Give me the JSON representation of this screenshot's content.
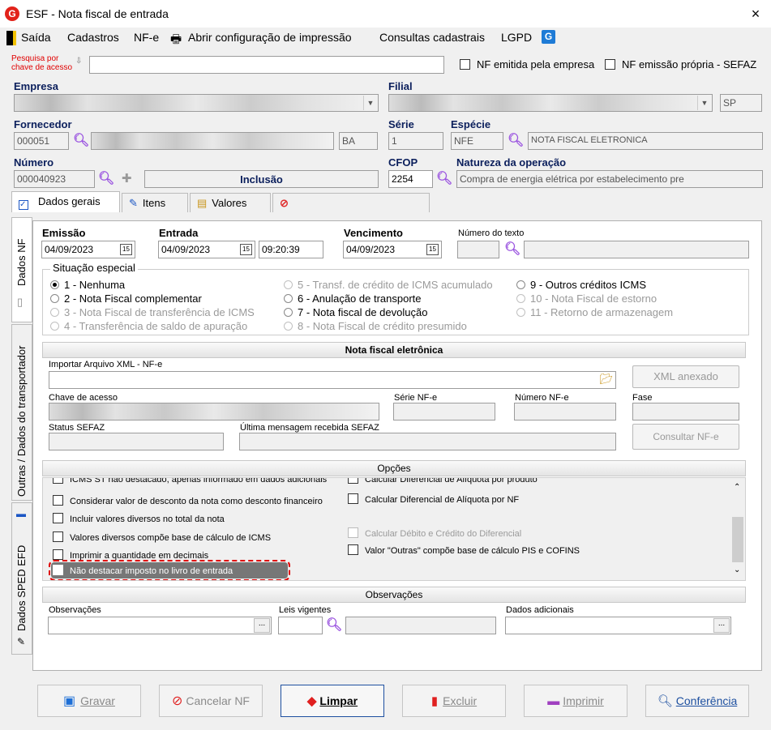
{
  "window": {
    "title": "ESF - Nota fiscal de entrada",
    "close": "×",
    "logo": "G"
  },
  "menu": {
    "saida": "Saída",
    "cadastros": "Cadastros",
    "nfe": "NF-e",
    "print_config": "Abrir configuração de impressão",
    "consultas": "Consultas cadastrais",
    "lgpd": "LGPD"
  },
  "search": {
    "label": "Pesquisa por chave de acesso",
    "value": "",
    "nf_emitida": "NF emitida pela empresa",
    "nf_propria": "NF emissão própria - SEFAZ"
  },
  "empresa": {
    "label": "Empresa",
    "value": ""
  },
  "filial": {
    "label": "Filial",
    "value": "",
    "uf": "SP"
  },
  "fornecedor": {
    "label": "Fornecedor",
    "code": "000051",
    "name": "",
    "uf": "BA"
  },
  "serie": {
    "label": "Série",
    "value": "1"
  },
  "especie": {
    "label": "Espécie",
    "code": "NFE",
    "desc": "NOTA FISCAL ELETRONICA"
  },
  "numero": {
    "label": "Número",
    "value": "000040923",
    "mode": "Inclusão"
  },
  "cfop": {
    "label": "CFOP",
    "value": "2254"
  },
  "natureza": {
    "label": "Natureza da operação",
    "value": "Compra de energia elétrica por estabelecimento pre"
  },
  "tabs": [
    "Dados gerais",
    "Itens",
    "Valores",
    ""
  ],
  "side_tabs": [
    "Dados NF",
    "Outras / Dados do transportador",
    "Dados SPED EFD"
  ],
  "dates": {
    "emissao_label": "Emissão",
    "emissao": "04/09/2023",
    "entrada_label": "Entrada",
    "entrada": "04/09/2023",
    "entrada_hora": "09:20:39",
    "venc_label": "Vencimento",
    "venc": "04/09/2023",
    "num_texto_label": "Número do texto"
  },
  "situacao": {
    "title": "Situação especial",
    "options": [
      "1 - Nenhuma",
      "2 - Nota Fiscal complementar",
      "3 - Nota Fiscal de transferência de ICMS",
      "4 - Transferência de saldo de apuração",
      "5 - Transf. de crédito de ICMS acumulado",
      "6 - Anulação de transporte",
      "7 - Nota fiscal de devolução",
      "8 - Nota Fiscal de crédito presumido",
      "9 - Outros créditos ICMS",
      "10 - Nota Fiscal de estorno",
      "11 - Retorno de armazenagem"
    ]
  },
  "nfe": {
    "title": "Nota fiscal eletrônica",
    "import_label": "Importar Arquivo XML - NF-e",
    "xml_btn": "XML anexado",
    "chave_label": "Chave de acesso",
    "serie_label": "Série NF-e",
    "numero_label": "Número NF-e",
    "fase_label": "Fase",
    "status_label": "Status SEFAZ",
    "msg_label": "Última mensagem recebida SEFAZ",
    "consultar_btn": "Consultar NF-e"
  },
  "opcoes": {
    "title": "Opções",
    "left": [
      "ICMS ST não destacado, apenas informado em dados adicionais",
      "Considerar valor de desconto da nota como desconto financeiro",
      "Incluir valores diversos no total da nota",
      "Valores diversos compõe base de cálculo de ICMS",
      "Imprimir a quantidade em decimais",
      "Não destacar imposto no livro de entrada"
    ],
    "right": [
      "Calcular Diferencial de Alíquota por produto",
      "Calcular Diferencial de Alíquota por NF",
      "Calcular Débito e Crédito do Diferencial",
      "Valor \"Outras\" compõe base de cálculo PIS e COFINS"
    ]
  },
  "obs": {
    "title": "Observações",
    "obs_label": "Observações",
    "leis_label": "Leis vigentes",
    "dados_label": "Dados adicionais",
    "ellipsis": "..."
  },
  "buttons": {
    "gravar": "Gravar",
    "cancelar": "Cancelar NF",
    "limpar": "Limpar",
    "excluir": "Excluir",
    "imprimir": "Imprimir",
    "conferencia": "Conferência"
  },
  "colors": {
    "accent": "#0b1f5c",
    "search_label": "#e00000",
    "highlight": "#e00000"
  }
}
